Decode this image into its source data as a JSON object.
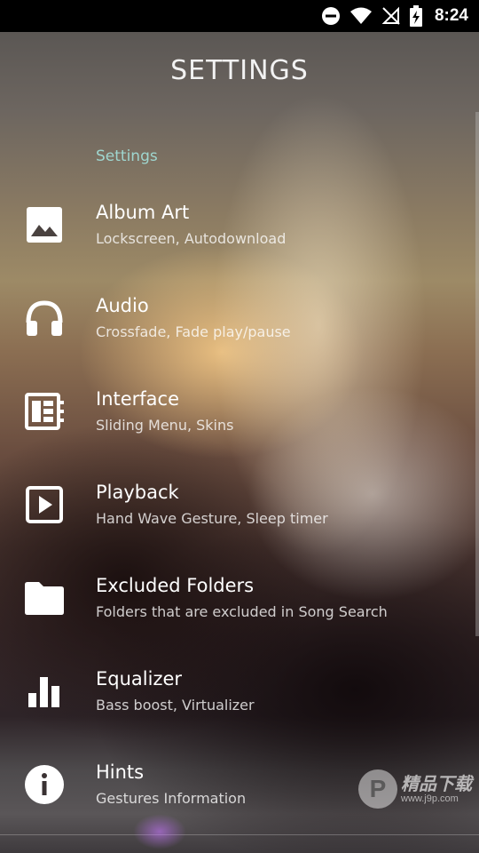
{
  "status_bar": {
    "time": "8:24",
    "icons": [
      "do-not-disturb-icon",
      "wifi-icon",
      "no-signal-icon",
      "battery-charging-icon"
    ]
  },
  "header": {
    "title": "SETTINGS"
  },
  "section": {
    "label": "Settings"
  },
  "items": [
    {
      "title": "Album Art",
      "subtitle": "Lockscreen, Autodownload",
      "icon": "image-icon"
    },
    {
      "title": "Audio",
      "subtitle": "Crossfade, Fade play/pause",
      "icon": "headphones-icon"
    },
    {
      "title": "Interface",
      "subtitle": "Sliding Menu, Skins",
      "icon": "interface-icon"
    },
    {
      "title": "Playback",
      "subtitle": "Hand Wave Gesture, Sleep timer",
      "icon": "play-icon"
    },
    {
      "title": "Excluded Folders",
      "subtitle": "Folders that are excluded in Song Search",
      "icon": "folder-icon"
    },
    {
      "title": "Equalizer",
      "subtitle": "Bass boost, Virtualizer",
      "icon": "equalizer-icon"
    },
    {
      "title": "Hints",
      "subtitle": "Gestures Information",
      "icon": "info-icon"
    }
  ],
  "watermark": {
    "name": "精品下载",
    "url": "www.j9p.com"
  },
  "colors": {
    "section_header": "#9fd6cf",
    "status_bar": "#000000"
  }
}
